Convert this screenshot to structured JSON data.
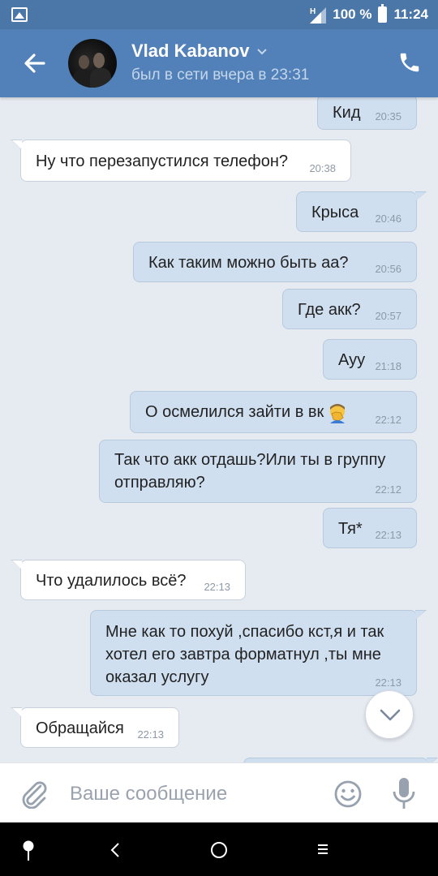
{
  "status_bar": {
    "network": "H",
    "battery": "100 %",
    "time": "11:24"
  },
  "header": {
    "name": "Vlad Kabanov",
    "last_seen": "был в сети вчера в 23:31"
  },
  "messages": [
    {
      "dir": "out",
      "text": "Кид",
      "time": "20:35"
    },
    {
      "dir": "in",
      "text": "Ну что перезапустился телефон?",
      "time": "20:38"
    },
    {
      "dir": "out",
      "text": "Крыса",
      "time": "20:46"
    },
    {
      "dir": "out",
      "text": "Как таким можно быть аа?",
      "time": "20:56"
    },
    {
      "dir": "out",
      "text": "Где акк?",
      "time": "20:57"
    },
    {
      "dir": "out",
      "text": "Ауу",
      "time": "21:18"
    },
    {
      "dir": "out",
      "text": "О осмелился зайти в вк",
      "emoji": "facepalm-emoji",
      "time": "22:12"
    },
    {
      "dir": "out",
      "text": "Так что акк отдашь?Или ты в группу\nотправляю?",
      "time": "22:12"
    },
    {
      "dir": "out",
      "text": "Тя*",
      "time": "22:13"
    },
    {
      "dir": "in",
      "text": "Что удалилось всё?",
      "time": "22:13"
    },
    {
      "dir": "out",
      "text": "Мне как то похуй ,спасибо кст,я и так\nхотел его завтра форматнул ,ты мне\nоказал услугу",
      "time": "22:13"
    },
    {
      "dir": "in",
      "text": "Обращайся",
      "time": "22:13"
    }
  ],
  "composer": {
    "placeholder": "Ваше сообщение"
  },
  "icons": {
    "back": "arrow-left-icon",
    "phone": "phone-icon",
    "attach": "paperclip-icon",
    "emoji": "smile-icon",
    "mic": "microphone-icon",
    "scroll": "chevron-down-icon"
  },
  "colors": {
    "header": "#5181b8",
    "statusbar": "#4a76a8",
    "chat_bg": "#e6ebf1",
    "outgoing_bubble": "#cfdff0",
    "incoming_bubble": "#ffffff"
  }
}
